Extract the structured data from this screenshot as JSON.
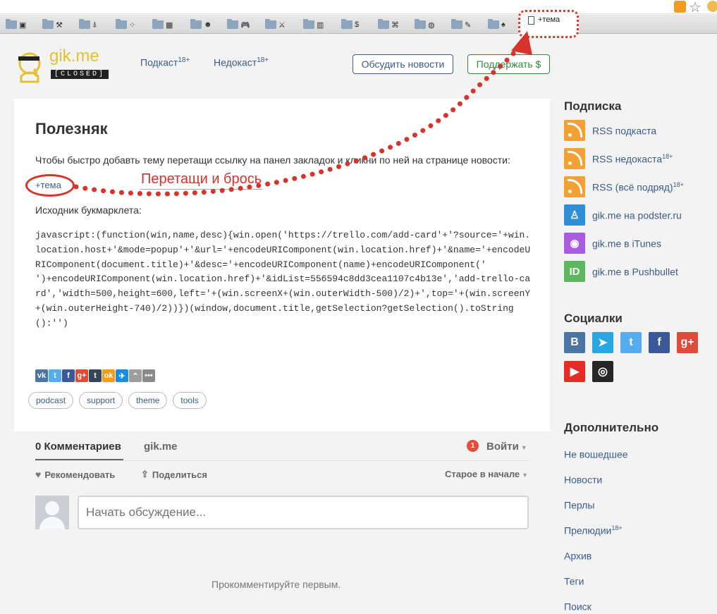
{
  "browser": {
    "bookmark_glyphs": [
      "▣",
      "⚒",
      "⍋",
      "⁘",
      "▦",
      "☻",
      "🎮",
      "⚔",
      "▥",
      "$",
      "⌘",
      "◍",
      "✎",
      "♠"
    ],
    "highlighted_bookmark": "+тема"
  },
  "header": {
    "logo_text": "gik.me",
    "logo_badge": "[CLOSED]",
    "nav": [
      {
        "label": "Подкаст",
        "sup": "18+"
      },
      {
        "label": "Недокаст",
        "sup": "18+"
      }
    ],
    "discuss_button": "Обсудить новости",
    "support_button": "Поддержать $"
  },
  "article": {
    "title": "Полезняк",
    "intro": "Чтобы быстро добавть тему перетащи ссылку на панел закладок и кликни по ней на странице новости:",
    "bookmarklet_link": "+тема",
    "drag_hint": "Перетащи и брось",
    "source_label": "Исходник букмарклета:",
    "code": "javascript:(function(win,name,desc){win.open('https://trello.com/add-card'+'?source='+win.location.host+'&mode=popup'+'&url='+encodeURIComponent(win.location.href)+'&name='+encodeURIComponent(document.title)+'&desc='+encodeURIComponent(name)+encodeURIComponent('\n')+encodeURIComponent(win.location.href)+'&idList=556594c8dd3cea1107c4b13e','add-trello-card','width=500,height=600,left='+(win.screenX+(win.outerWidth-500)/2)+',top='+(win.screenY+(win.outerHeight-740)/2))})(window,document.title,getSelection?getSelection().toString():'')",
    "share_icons": [
      {
        "name": "vk",
        "glyph": "vk",
        "color": "#4c75a3"
      },
      {
        "name": "twitter",
        "glyph": "t",
        "color": "#55acee"
      },
      {
        "name": "facebook",
        "glyph": "f",
        "color": "#3b5998"
      },
      {
        "name": "gplus",
        "glyph": "g+",
        "color": "#dd4b39"
      },
      {
        "name": "tumblr",
        "glyph": "t",
        "color": "#35465c"
      },
      {
        "name": "odnoklassniki",
        "glyph": "ok",
        "color": "#f59a1a"
      },
      {
        "name": "mailru",
        "glyph": "✈",
        "color": "#168de2"
      },
      {
        "name": "surfingbird",
        "glyph": "⌃",
        "color": "#9e9e9e"
      },
      {
        "name": "more",
        "glyph": "•••",
        "color": "#8a8a8a"
      }
    ],
    "tags": [
      "podcast",
      "support",
      "theme",
      "tools"
    ]
  },
  "comments": {
    "count_label": "0 Комментариев",
    "site_tab": "gik.me",
    "badge": "1",
    "login": "Войти",
    "recommend": "Рекомендовать",
    "share": "Поделиться",
    "sort": "Старое в начале",
    "placeholder": "Начать обсуждение...",
    "empty": "Прокомментируйте первым."
  },
  "sidebar": {
    "subscription_title": "Подписка",
    "subscriptions": [
      {
        "label": "RSS подкаста",
        "sup": "",
        "icon": "rss-icon",
        "color": "#f5a032"
      },
      {
        "label": "RSS недокаста",
        "sup": "18+",
        "icon": "rss-icon",
        "color": "#f5a032"
      },
      {
        "label": "RSS (всё подряд)",
        "sup": "18+",
        "icon": "rss-icon",
        "color": "#f5a032"
      },
      {
        "label": "gik.me на podster.ru",
        "sup": "",
        "icon": "podster-icon",
        "color": "#2e8fd6",
        "glyph": "♙"
      },
      {
        "label": "gik.me в iTunes",
        "sup": "",
        "icon": "itunes-icon",
        "color": "#a95ce0",
        "glyph": "◉"
      },
      {
        "label": "gik.me в Pushbullet",
        "sup": "",
        "icon": "pushbullet-icon",
        "color": "#5cb85c",
        "glyph": "ID"
      }
    ],
    "social_title": "Социалки",
    "socials": [
      {
        "name": "vk",
        "glyph": "В",
        "color": "#4c75a3"
      },
      {
        "name": "telegram",
        "glyph": "➤",
        "color": "#2ca5e0"
      },
      {
        "name": "twitter",
        "glyph": "t",
        "color": "#55acee"
      },
      {
        "name": "facebook",
        "glyph": "f",
        "color": "#3b5998"
      },
      {
        "name": "gplus",
        "glyph": "g+",
        "color": "#dd4b39"
      },
      {
        "name": "youtube",
        "glyph": "▶",
        "color": "#e52d27"
      },
      {
        "name": "instagram",
        "glyph": "◎",
        "color": "#262626"
      }
    ],
    "extra_title": "Дополнительно",
    "extra_links": [
      {
        "label": "Не вошедшее",
        "sup": ""
      },
      {
        "label": "Новости",
        "sup": ""
      },
      {
        "label": "Перлы",
        "sup": ""
      },
      {
        "label": "Прелюдии",
        "sup": "18+"
      },
      {
        "label": "Архив",
        "sup": ""
      },
      {
        "label": "Теги",
        "sup": ""
      },
      {
        "label": "Поиск",
        "sup": ""
      }
    ]
  }
}
